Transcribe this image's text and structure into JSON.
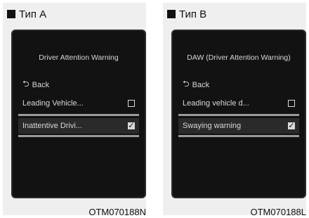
{
  "panels": [
    {
      "type_label": "Тип A",
      "screen": {
        "title": "Driver Attention Warning",
        "back_label": "Back",
        "items": [
          {
            "label": "Leading Vehicle...",
            "checked": false
          },
          {
            "label": "Inattentive Drivi...",
            "checked": true
          }
        ]
      },
      "code": "OTM070188N"
    },
    {
      "type_label": "Тип B",
      "screen": {
        "title": "DAW (Driver Attention Warning)",
        "back_label": "Back",
        "items": [
          {
            "label": "Leading vehicle d...",
            "checked": false
          },
          {
            "label": "Swaying warning",
            "checked": true
          }
        ]
      },
      "code": "OTM070188L"
    }
  ]
}
